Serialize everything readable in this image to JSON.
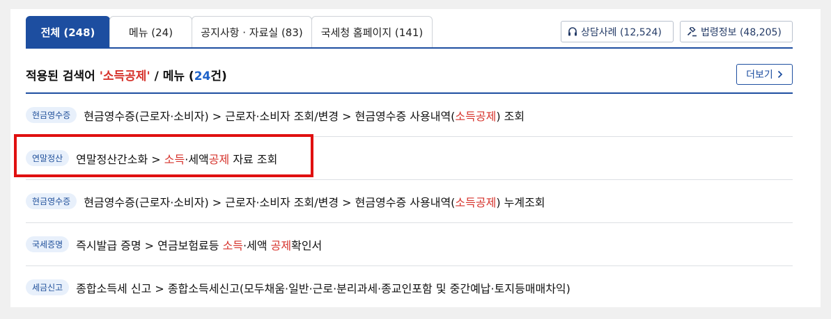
{
  "tabs": [
    {
      "label": "전체 (248)",
      "active": true
    },
    {
      "label": "메뉴 (24)",
      "active": false
    },
    {
      "label": "공지사항 · 자료실 (83)",
      "active": false
    },
    {
      "label": "국세청 홈페이지 (141)",
      "active": false
    }
  ],
  "stats": {
    "consult_label": "상담사례 (12,524)",
    "consult_icon": "headset-icon",
    "law_label": "법령정보 (48,205)",
    "law_icon": "gavel-icon"
  },
  "heading": {
    "prefix": "적용된 검색어 ",
    "keyword": "'소득공제'",
    "middle": " / 메뉴 (",
    "count": "24",
    "suffix": "건)"
  },
  "more_button": {
    "label": "더보기",
    "icon": "chevron-right-icon"
  },
  "rows": [
    {
      "badge": "현금영수증",
      "segments": [
        "현금영수증(근로자·소비자) > 근로자·소비자 조회/변경 > 현금영수증 사용내역(",
        "소득공제",
        ") 조회"
      ]
    },
    {
      "badge": "연말정산",
      "segments": [
        "연말정산간소화 > ",
        "소득",
        "·세액",
        "공제",
        " 자료 조회"
      ]
    },
    {
      "badge": "현금영수증",
      "segments": [
        "현금영수증(근로자·소비자) > 근로자·소비자 조회/변경 > 현금영수증 사용내역(",
        "소득공제",
        ") 누계조회"
      ]
    },
    {
      "badge": "국세증명",
      "segments": [
        "즉시발급 증명 > 연금보험료등 ",
        "소득",
        "·세액 ",
        "공제",
        "확인서"
      ]
    },
    {
      "badge": "세금신고",
      "segments": [
        "종합소득세 신고 > 종합소득세신고(모두채움·일반·근로·분리과세·종교인포함 및 중간예납·토지등매매차익)"
      ]
    }
  ],
  "colors": {
    "accent": "#1d4ea0",
    "keyword": "#d6322b",
    "count": "#1d62c9",
    "highlight_box": "#e01010"
  }
}
